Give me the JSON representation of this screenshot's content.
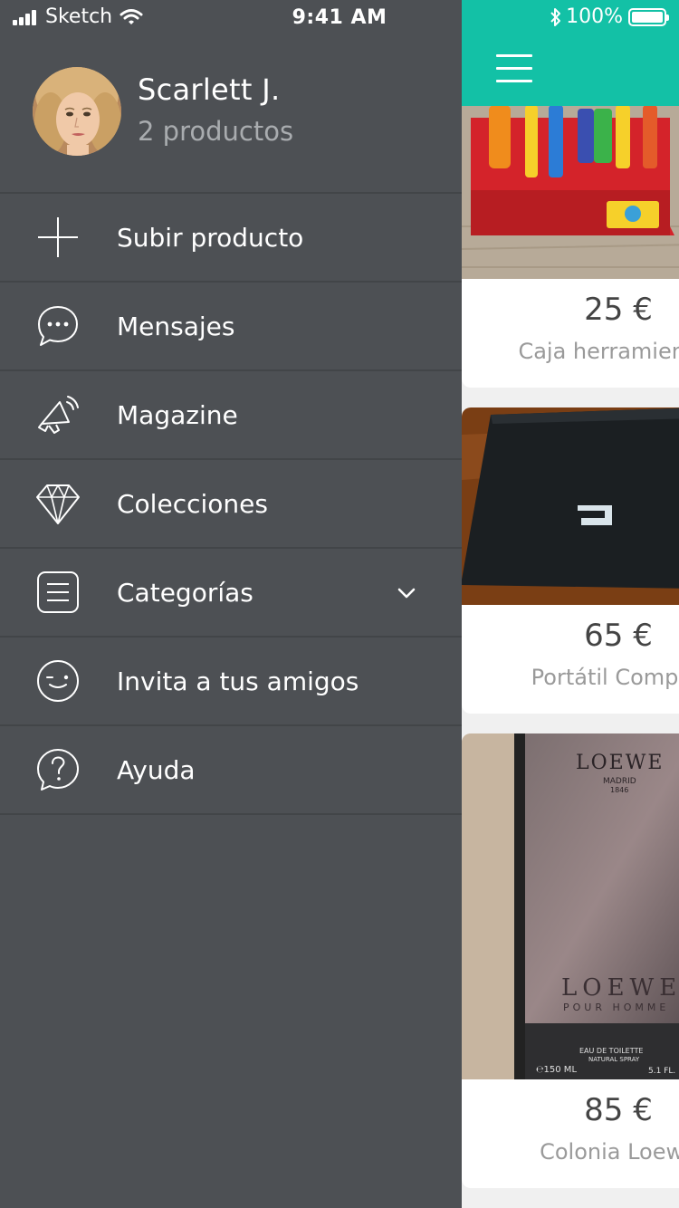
{
  "status_bar": {
    "carrier": "Sketch",
    "time": "9:41 AM",
    "battery": "100%"
  },
  "profile": {
    "name": "Scarlett J.",
    "subtitle": "2 productos"
  },
  "menu": {
    "items": [
      {
        "label": "Subir producto",
        "icon": "plus-icon"
      },
      {
        "label": "Mensajes",
        "icon": "chat-bubble-icon"
      },
      {
        "label": "Magazine",
        "icon": "megaphone-icon"
      },
      {
        "label": "Colecciones",
        "icon": "diamond-icon"
      },
      {
        "label": "Categorías",
        "icon": "list-icon",
        "expandable": true
      },
      {
        "label": "Invita a tus amigos",
        "icon": "wink-face-icon"
      },
      {
        "label": "Ayuda",
        "icon": "help-bubble-icon"
      }
    ]
  },
  "header": {
    "menu_icon": "hamburger-icon",
    "color": "#13c1a6"
  },
  "products": [
    {
      "price": "25 €",
      "title": "Caja herramientas"
    },
    {
      "price": "65 €",
      "title": "Portátil Compaq"
    },
    {
      "price": "85 €",
      "title": "Colonia Loewe"
    }
  ],
  "product_images": {
    "perfume_brand": "LOEWE",
    "perfume_city": "MADRID",
    "perfume_year": "1846",
    "perfume_line": "LOEWE",
    "perfume_sub": "POUR HOMME",
    "perfume_type": "EAU DE TOILETTE",
    "perfume_spray": "NATURAL SPRAY",
    "perfume_ml": "℮150 ML",
    "perfume_oz": "5.1 FL."
  },
  "colors": {
    "drawer_bg": "#4d5054",
    "accent": "#13c1a6",
    "divider": "#424548"
  }
}
